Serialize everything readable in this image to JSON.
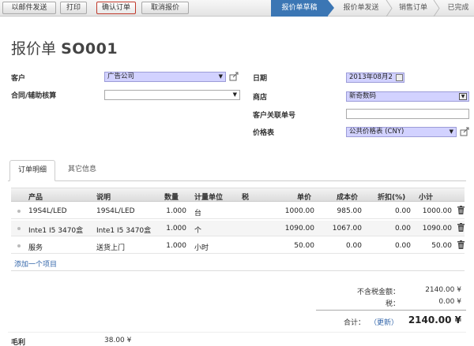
{
  "toolbar": {
    "send_email": "以邮件发送",
    "print": "打印",
    "confirm": "确认订单",
    "cancel": "取消报价"
  },
  "statusbar": {
    "steps": [
      "报价单草稿",
      "报价单发送",
      "销售订单",
      "已完成"
    ],
    "active_index": 0
  },
  "header": {
    "prefix": "报价单",
    "number": "SO001"
  },
  "form": {
    "customer_label": "客户",
    "customer_value": "广告公司",
    "contract_label": "合同/辅助核算",
    "contract_value": "",
    "date_label": "日期",
    "date_value": "2013年08月2",
    "shop_label": "商店",
    "shop_value": "新奇数码",
    "client_ref_label": "客户关联单号",
    "client_ref_value": "",
    "pricelist_label": "价格表",
    "pricelist_value": "公共价格表 (CNY)"
  },
  "tabs": [
    "订单明细",
    "其它信息"
  ],
  "table": {
    "headers": [
      "产品",
      "说明",
      "数量",
      "计量单位",
      "税",
      "单价",
      "成本价",
      "折扣(%)",
      "小计"
    ],
    "rows": [
      {
        "product": "19S4L/LED",
        "desc": "19S4L/LED",
        "qty": "1.000",
        "uom": "台",
        "tax": "",
        "price": "1000.00",
        "cost": "985.00",
        "discount": "0.00",
        "subtotal": "1000.00"
      },
      {
        "product": "Inte1 I5 3470盒",
        "desc": "Inte1 I5 3470盒",
        "qty": "1.000",
        "uom": "个",
        "tax": "",
        "price": "1090.00",
        "cost": "1067.00",
        "discount": "0.00",
        "subtotal": "1090.00"
      },
      {
        "product": "服务",
        "desc": "送货上门",
        "qty": "1.000",
        "uom": "小时",
        "tax": "",
        "price": "50.00",
        "cost": "0.00",
        "discount": "0.00",
        "subtotal": "50.00"
      }
    ],
    "add_item": "添加一个项目"
  },
  "totals": {
    "untaxed_label": "不含税金额：",
    "untaxed_value": "2140.00 ¥",
    "tax_label": "税：",
    "tax_value": "0.00 ¥",
    "total_label": "合计：",
    "refresh_label": "（更新）",
    "total_value": "2140.00 ¥"
  },
  "margin": {
    "label": "毛利",
    "value": "38.00 ¥"
  },
  "colors": {
    "active_step": "#3b76b4",
    "required_field": "#d2d2ff",
    "link": "#3366aa"
  }
}
